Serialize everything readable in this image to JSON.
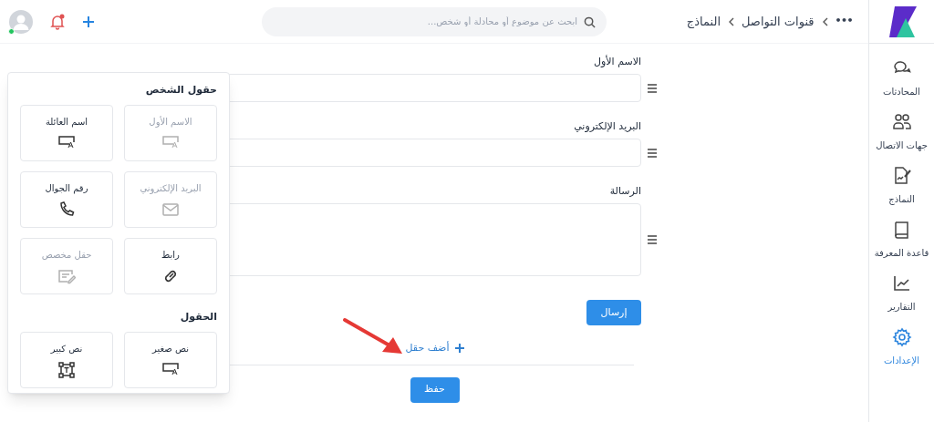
{
  "sidebar": {
    "items": [
      {
        "label": "المحادثات",
        "selected": false
      },
      {
        "label": "جهات الاتصال",
        "selected": false
      },
      {
        "label": "النماذج",
        "selected": false
      },
      {
        "label": "قاعدة المعرفة",
        "selected": false
      },
      {
        "label": "التقارير",
        "selected": false
      },
      {
        "label": "الإعدادات",
        "selected": true
      }
    ]
  },
  "breadcrumb": [
    "•••",
    "قنوات التواصل",
    "النماذج"
  ],
  "search": {
    "placeholder": "ابحث عن موضوع أو محادلة أو شخص..."
  },
  "user": {
    "online": true
  },
  "notifications": {
    "unread": true
  },
  "form": {
    "fields": [
      {
        "label": "الاسم الأول",
        "kind": "input"
      },
      {
        "label": "البريد الإلكتروني",
        "kind": "input"
      },
      {
        "label": "الرسالة",
        "kind": "textarea"
      }
    ],
    "submit_button": "إرسال",
    "add_field": "أضف حقل",
    "save_button": "حفظ"
  },
  "field_picker": {
    "sections": [
      {
        "title": "حقول الشخص",
        "items": [
          {
            "label": "الاسم الأول",
            "kind": "text",
            "disabled": true
          },
          {
            "label": "اسم العائلة",
            "kind": "text",
            "disabled": false
          },
          {
            "label": "البريد الإلكتروني",
            "kind": "email",
            "disabled": true
          },
          {
            "label": "رقم الجوال",
            "kind": "phone",
            "disabled": false
          },
          {
            "label": "رابط",
            "kind": "link",
            "disabled": false
          },
          {
            "label": "حقل مخصص",
            "kind": "custom",
            "disabled": true
          }
        ]
      },
      {
        "title": "الحقول",
        "items": [
          {
            "label": "نص صغير",
            "kind": "text",
            "disabled": false
          },
          {
            "label": "نص كبير",
            "kind": "multiline",
            "disabled": false
          }
        ]
      }
    ]
  }
}
